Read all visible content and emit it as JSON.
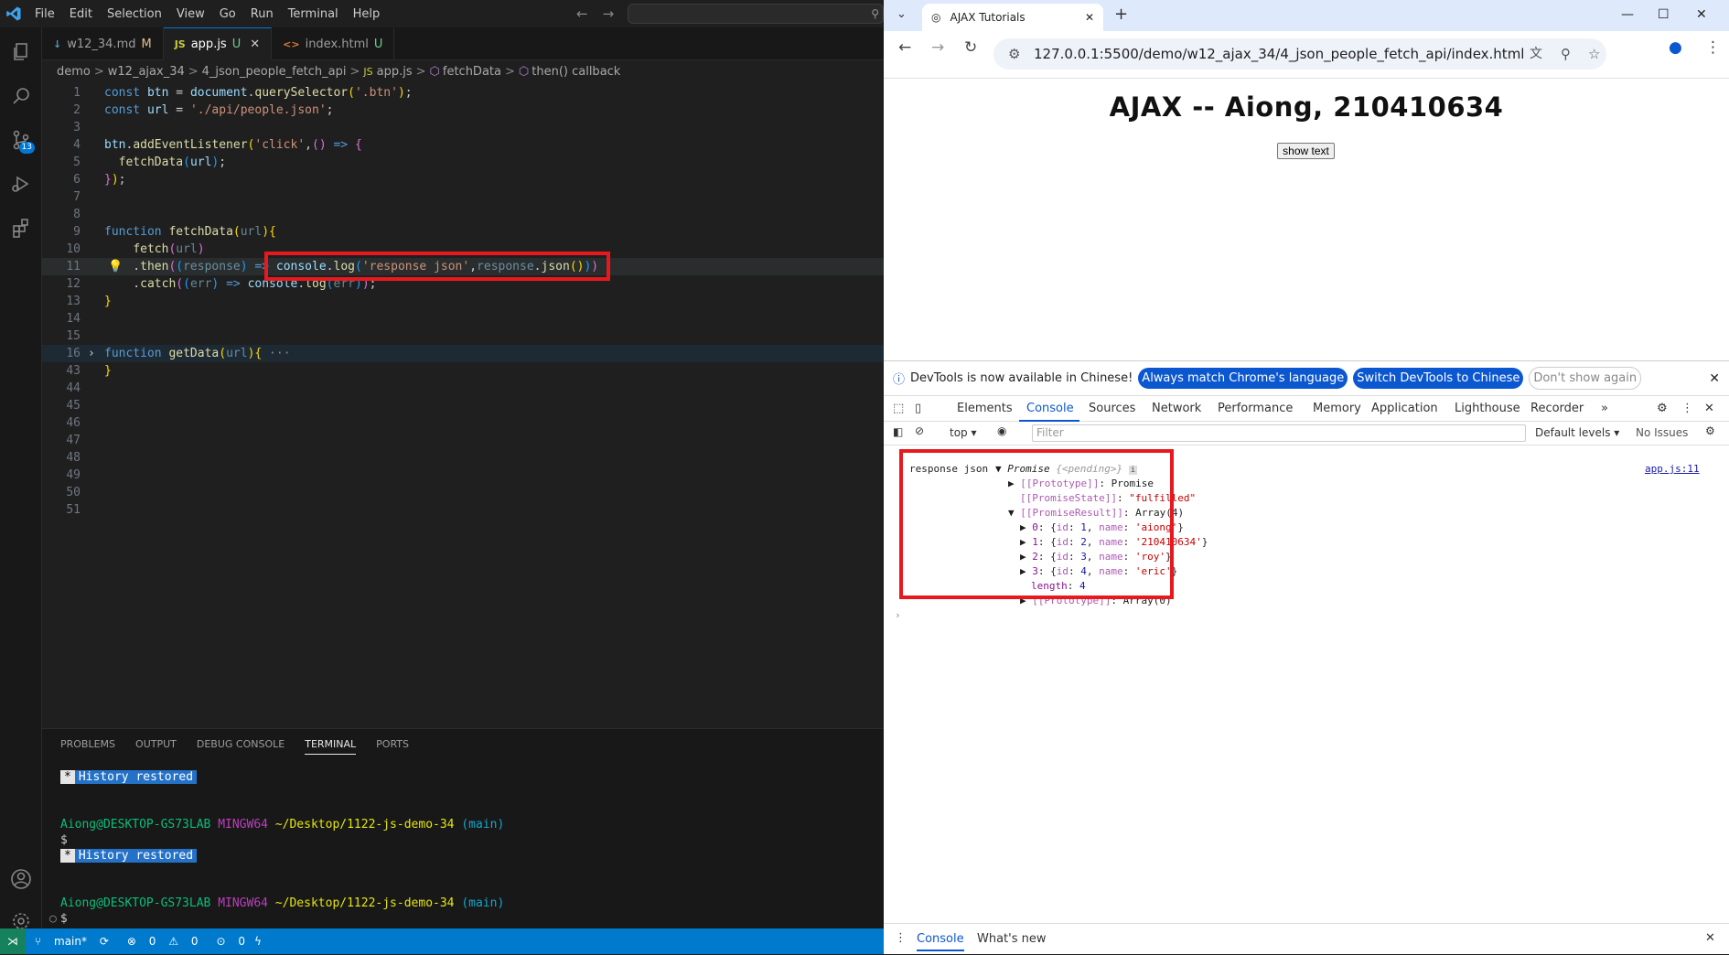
{
  "vscode": {
    "menu": [
      "File",
      "Edit",
      "Selection",
      "View",
      "Go",
      "Run",
      "Terminal",
      "Help"
    ],
    "tabs": [
      {
        "icon": "↓",
        "name": "w12_34.md",
        "status": "M"
      },
      {
        "icon": "JS",
        "name": "app.js",
        "status": "U"
      },
      {
        "icon": "<>",
        "name": "index.html",
        "status": "U"
      }
    ],
    "breadcrumb": [
      "demo",
      "w12_ajax_34",
      "4_json_people_fetch_api",
      "app.js",
      "fetchData",
      "then() callback"
    ],
    "scm_badge": "13",
    "panel_tabs": [
      "PROBLEMS",
      "OUTPUT",
      "DEBUG CONSOLE",
      "TERMINAL",
      "PORTS"
    ],
    "terminal": {
      "history": "History restored",
      "user": "Aiong@DESKTOP-GS73LAB",
      "shell": "MINGW64",
      "path": "~/Desktop/1122-js-demo-34",
      "branch": "(main)",
      "prompt": "$"
    },
    "status": {
      "branch": "main*",
      "errors": "0",
      "warnings": "0",
      "ports": "0"
    }
  },
  "chrome": {
    "tab_title": "AJAX Tutorials",
    "url": "127.0.0.1:5500/demo/w12_ajax_34/4_json_people_fetch_api/index.html",
    "page_heading": "AJAX -- Aiong, 210410634",
    "button_label": "show text"
  },
  "devtools": {
    "info_text": "DevTools is now available in Chinese!",
    "btn_match": "Always match Chrome's language",
    "btn_switch": "Switch DevTools to Chinese",
    "btn_dont": "Don't show again",
    "tabs": [
      "Elements",
      "Console",
      "Sources",
      "Network",
      "Performance",
      "Memory",
      "Application",
      "Lighthouse",
      "Recorder"
    ],
    "context": "top",
    "filter_placeholder": "Filter",
    "levels": "Default levels",
    "issues": "No Issues",
    "source_link": "app.js:11",
    "log_label": "response json",
    "footer_tabs": [
      "Console",
      "What's new"
    ]
  }
}
